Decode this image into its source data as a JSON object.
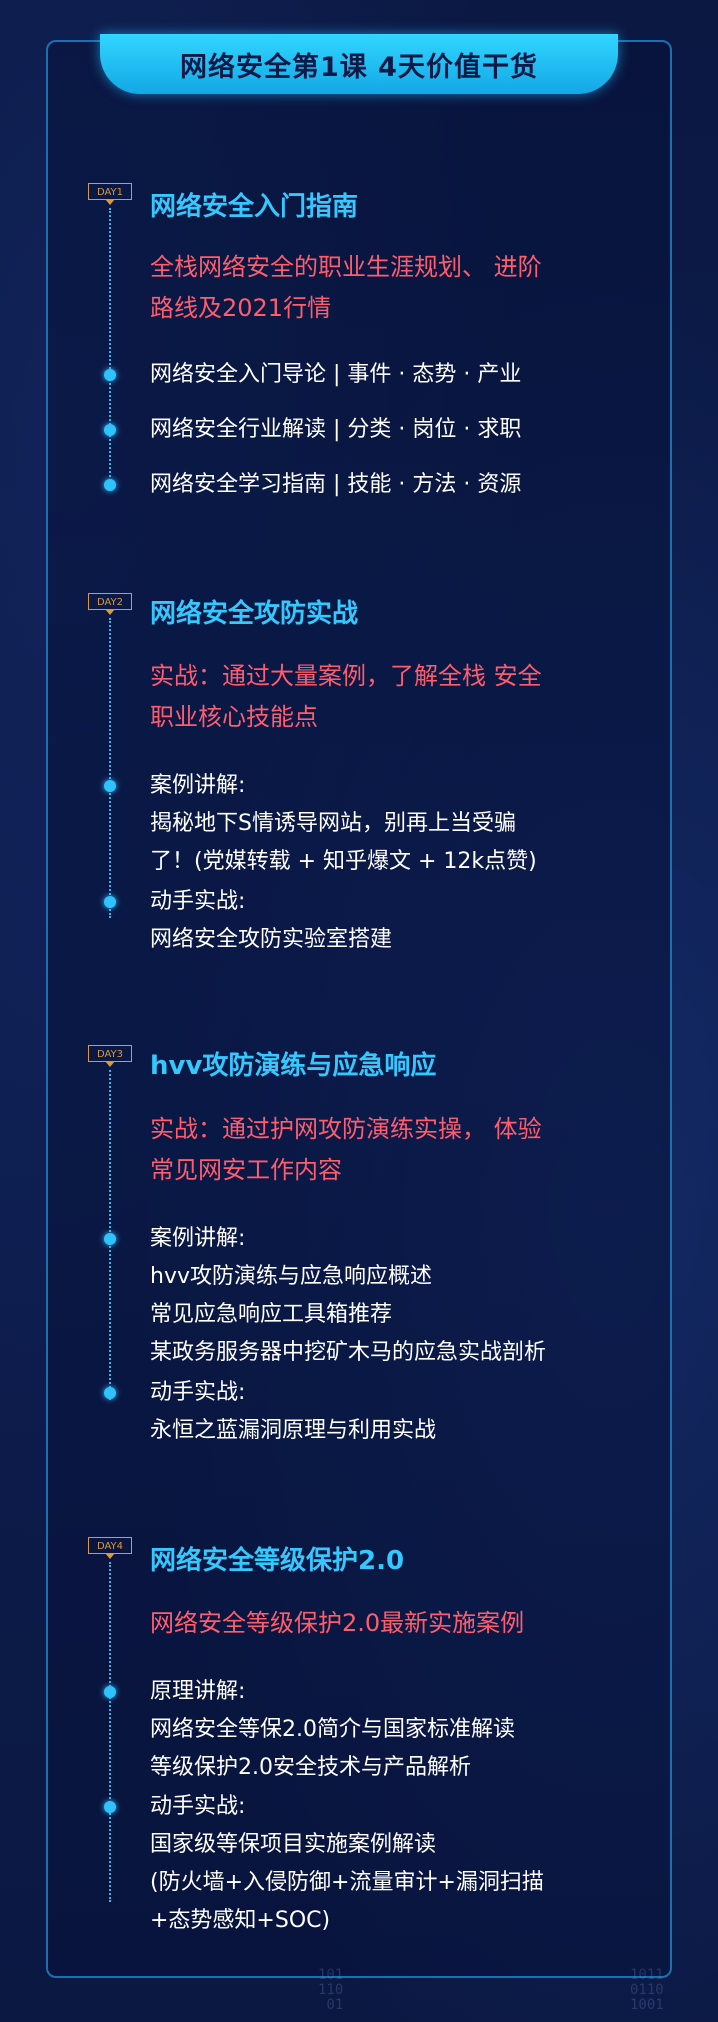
{
  "header": {
    "title": "网络安全第1课 4天价值干货"
  },
  "days": [
    {
      "badge": "DAY1",
      "title": "网络安全入门指南",
      "subtitle": [
        "全栈网络安全的职业生涯规划、 进阶",
        "路线及2021行情"
      ],
      "items": [
        [
          "网络安全入门导论 | 事件 · 态势 · 产业"
        ],
        [
          "网络安全行业解读 | 分类 · 岗位 · 求职"
        ],
        [
          "网络安全学习指南 | 技能 · 方法 · 资源"
        ]
      ]
    },
    {
      "badge": "DAY2",
      "title": "网络安全攻防实战",
      "subtitle": [
        "实战：通过大量案例，了解全栈 安全",
        "职业核心技能点"
      ],
      "items": [
        [
          "案例讲解:",
          "揭秘地下S情诱导网站，别再上当受骗",
          "了！(党媒转载 + 知乎爆文 + 12k点赞)"
        ],
        [
          "动手实战:",
          "网络安全攻防实验室搭建"
        ]
      ]
    },
    {
      "badge": "DAY3",
      "title": "hvv攻防演练与应急响应",
      "subtitle": [
        "实战：通过护网攻防演练实操， 体验",
        "常见网安工作内容"
      ],
      "items": [
        [
          "案例讲解:",
          "hvv攻防演练与应急响应概述",
          "常见应急响应工具箱推荐",
          "某政务服务器中挖矿木马的应急实战剖析"
        ],
        [
          "动手实战:",
          "永恒之蓝漏洞原理与利用实战"
        ]
      ]
    },
    {
      "badge": "DAY4",
      "title": "网络安全等级保护2.0",
      "subtitle": [
        "网络安全等级保护2.0最新实施案例"
      ],
      "items": [
        [
          "原理讲解:",
          "网络安全等保2.0简介与国家标准解读",
          "等级保护2.0安全技术与产品解析"
        ],
        [
          "动手实战:",
          "国家级等保项目实施案例解读",
          "(防火墙+入侵防御+流量审计+漏洞扫描",
          "+态势感知+SOC)"
        ]
      ]
    }
  ],
  "decor": {
    "binary_left": "101\n110\n 01",
    "binary_right": "1011\n0110\n1001"
  },
  "colors": {
    "title": "#35c8ff",
    "subtitle": "#ff5d6c",
    "text": "#ffffff",
    "badge": "#d89a3a",
    "accent": "#2fc2ff"
  }
}
